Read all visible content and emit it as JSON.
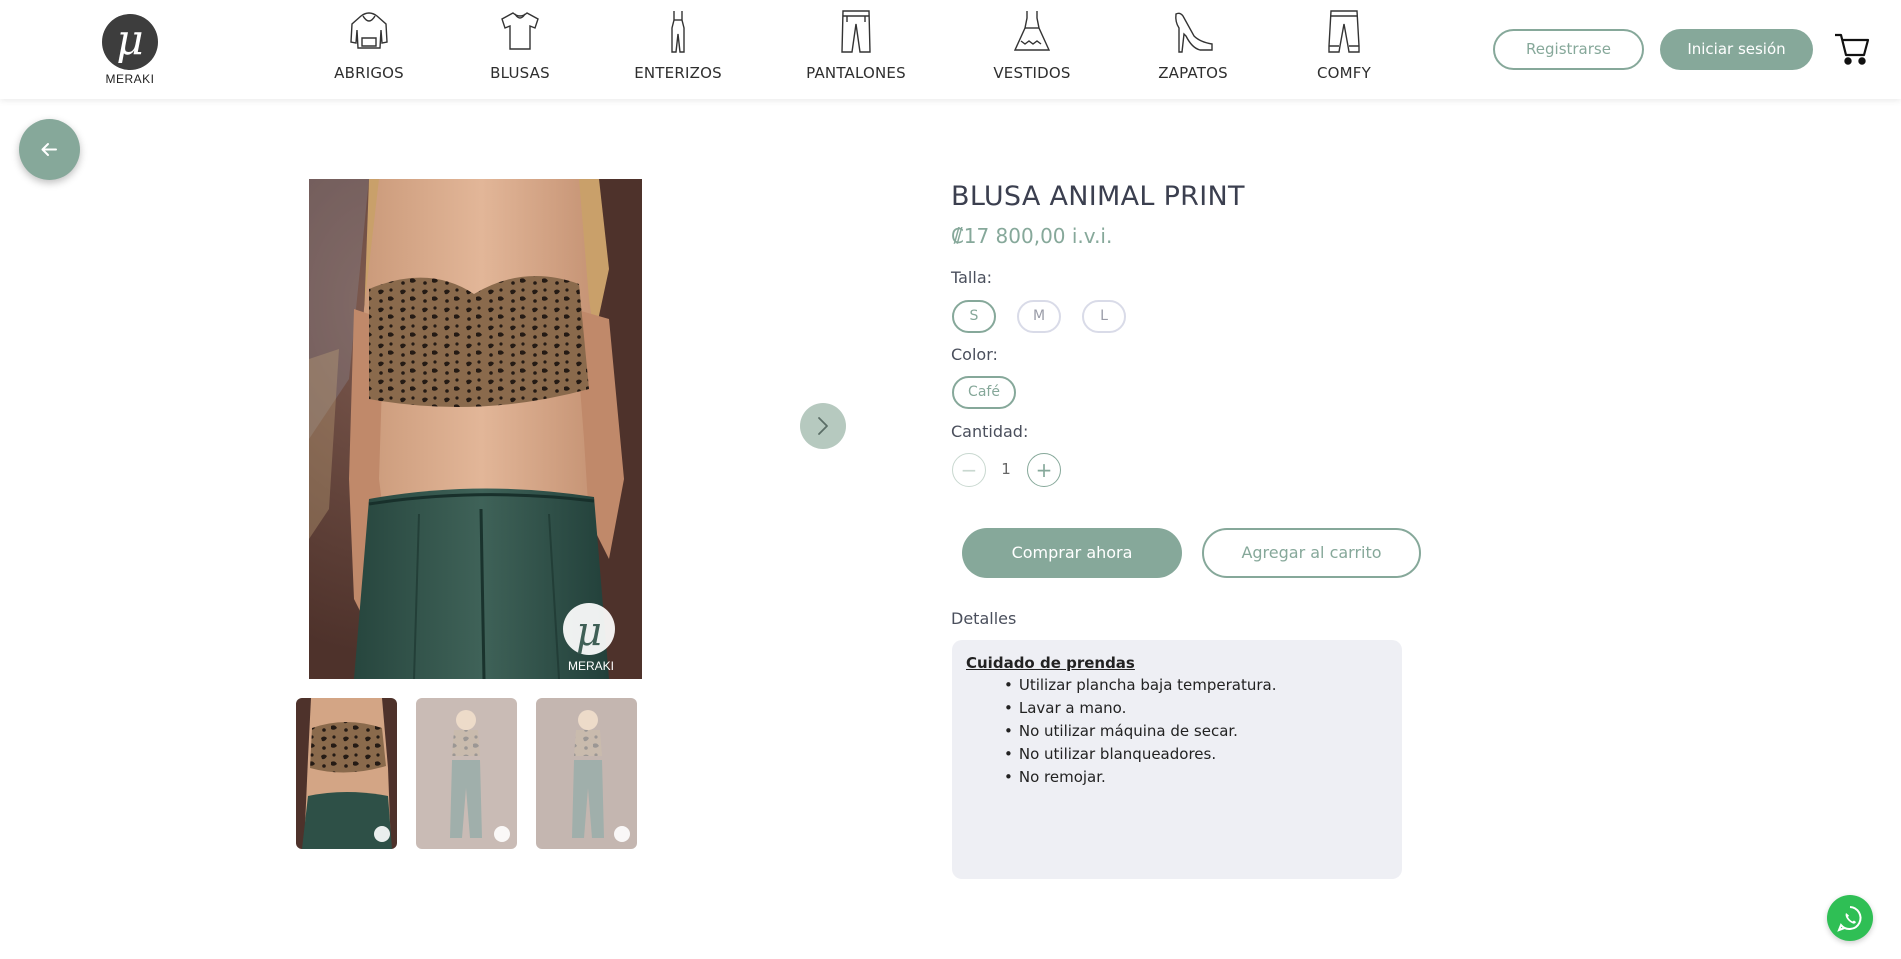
{
  "brand": {
    "name": "MERAKI",
    "logo_glyph": "μ"
  },
  "nav": {
    "items": [
      {
        "label": "ABRIGOS",
        "icon": "hoodie-icon"
      },
      {
        "label": "BLUSAS",
        "icon": "tshirt-icon"
      },
      {
        "label": "ENTERIZOS",
        "icon": "jumpsuit-icon"
      },
      {
        "label": "PANTALONES",
        "icon": "pants-icon"
      },
      {
        "label": "VESTIDOS",
        "icon": "dress-icon"
      },
      {
        "label": "ZAPATOS",
        "icon": "heel-shoe-icon"
      },
      {
        "label": "COMFY",
        "icon": "joggers-icon"
      }
    ]
  },
  "header": {
    "register_label": "Registrarse",
    "login_label": "Iniciar sesión",
    "cart_icon": "cart-icon"
  },
  "gallery": {
    "back_icon": "arrow-left-icon",
    "next_icon": "chevron-right-icon",
    "watermark": "MERAKI",
    "thumbnails": [
      {
        "selected": true
      },
      {
        "selected": false
      },
      {
        "selected": false
      }
    ]
  },
  "product": {
    "title": "BLUSA ANIMAL PRINT",
    "price": "₡17 800,00 i.v.i.",
    "size_label": "Talla:",
    "sizes": [
      "S",
      "M",
      "L"
    ],
    "selected_size": "S",
    "color_label": "Color:",
    "colors": [
      "Café"
    ],
    "selected_color": "Café",
    "quantity_label": "Cantidad:",
    "quantity": "1",
    "minus": "−",
    "plus": "+",
    "buy_now_label": "Comprar ahora",
    "add_to_cart_label": "Agregar al carrito",
    "details_label": "Detalles",
    "details": {
      "title": "Cuidado de prendas",
      "items": [
        "Utilizar plancha baja temperatura.",
        "Lavar a mano.",
        "No utilizar máquina de secar.",
        "No utilizar blanqueadores.",
        "No remojar."
      ]
    }
  },
  "colors": {
    "accent": "#86a89a",
    "accent_light": "#b6c9bf",
    "title": "#3b3f4f",
    "details_bg": "#eeeff4",
    "whatsapp": "#2fbf55"
  },
  "floating": {
    "whatsapp_icon": "whatsapp-icon"
  }
}
